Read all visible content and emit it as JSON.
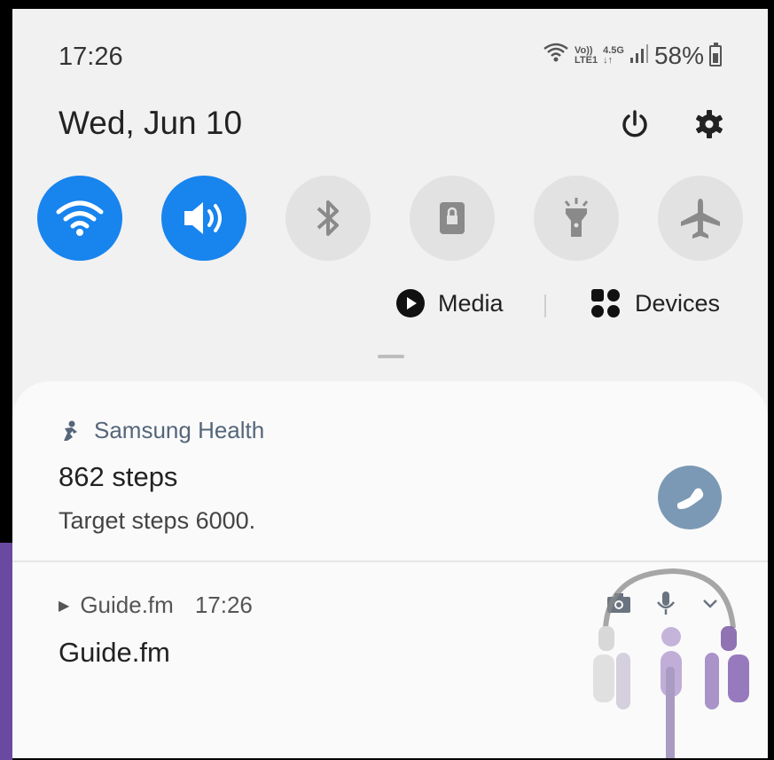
{
  "status_bar": {
    "time": "17:26",
    "volte": "Vo))",
    "lte": "LTE1",
    "net_type": "4.5G",
    "battery": "58%"
  },
  "header": {
    "date": "Wed, Jun 10"
  },
  "quick_tiles": [
    {
      "name": "wifi-icon",
      "state": "on"
    },
    {
      "name": "sound-icon",
      "state": "on"
    },
    {
      "name": "bluetooth-icon",
      "state": "off"
    },
    {
      "name": "rotation-lock-icon",
      "state": "off"
    },
    {
      "name": "flashlight-icon",
      "state": "off"
    },
    {
      "name": "airplane-mode-icon",
      "state": "off"
    }
  ],
  "media_controls": {
    "media_label": "Media",
    "devices_label": "Devices"
  },
  "notifications": {
    "health": {
      "app_name": "Samsung Health",
      "title": "862 steps",
      "text": "Target steps 6000."
    },
    "guide": {
      "app_name": "Guide.fm",
      "time": "17:26",
      "title": "Guide.fm"
    }
  },
  "colors": {
    "accent_on": "#1884ee",
    "tile_off": "#e2e2e2",
    "health_button": "#7b99b5",
    "logo_purple": "#7b5aa6"
  }
}
